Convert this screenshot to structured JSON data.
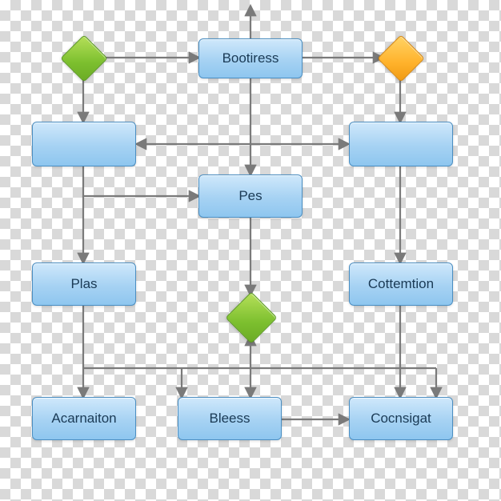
{
  "boxes": {
    "bootiress": "Bootiress",
    "row2left": "",
    "row2right": "",
    "pes": "Pes",
    "plas": "Plas",
    "cottemtion": "Cottemtion",
    "acarnaiton": "Acarnaiton",
    "bleess": "Bleess",
    "cocnsigat": "Cocnsigat"
  },
  "decisions": {
    "top_left": {
      "shape": "diamond",
      "color": "green"
    },
    "top_right": {
      "shape": "diamond",
      "color": "orange"
    },
    "mid": {
      "shape": "diamond",
      "color": "green"
    }
  },
  "palette": {
    "box_fill_top": "#cfe8fb",
    "box_fill_bottom": "#8ec6ef",
    "box_border": "#4a8ec2",
    "diamond_green": "#7cbf2e",
    "diamond_orange": "#ffb22b",
    "arrow": "#7a7a7a"
  }
}
